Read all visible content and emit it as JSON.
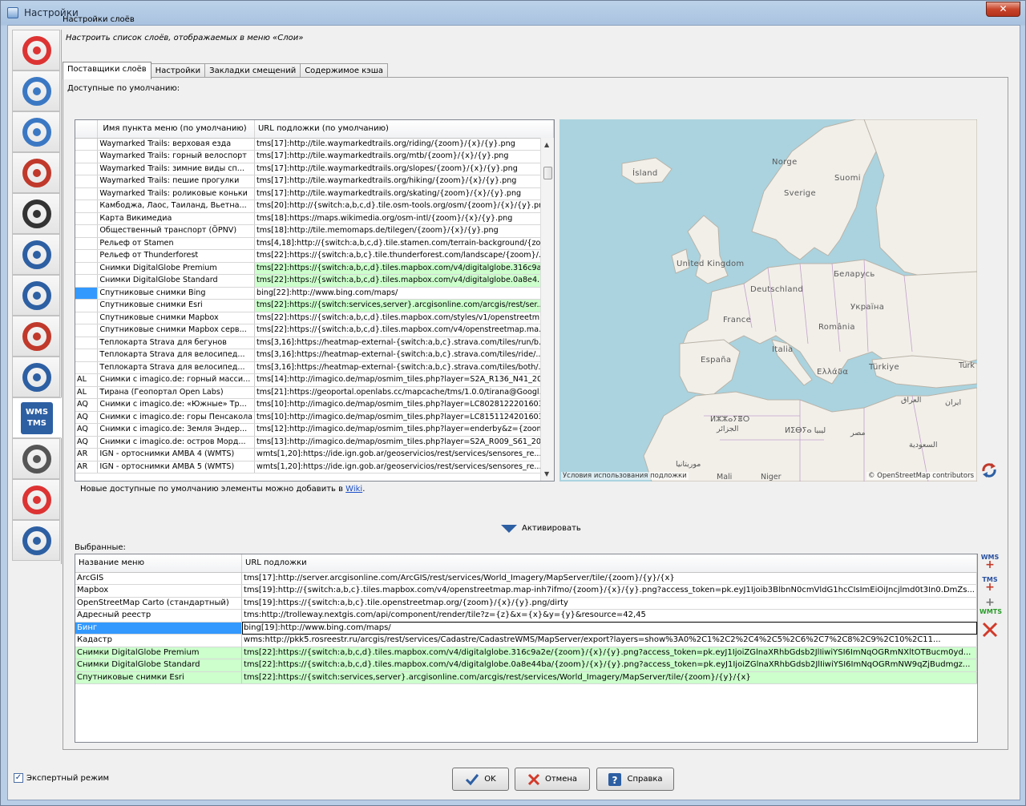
{
  "window": {
    "title": "Настройки",
    "close_label": "✕"
  },
  "header": {
    "title": "Настройки слоёв",
    "description": "Настроить список слоёв, отображаемых в меню «Слои»"
  },
  "sidebar": {
    "items": [
      {
        "icon": "display-settings-icon"
      },
      {
        "icon": "cloud-connection-icon"
      },
      {
        "icon": "globe-projection-icon"
      },
      {
        "icon": "plugin-puzzle-icon"
      },
      {
        "icon": "file-storage-icon"
      },
      {
        "icon": "audio-speaker-icon"
      },
      {
        "icon": "keyboard-icon"
      },
      {
        "icon": "validator-checkbox-icon"
      },
      {
        "icon": "remote-control-icon"
      },
      {
        "icon": "wms-tms-icon",
        "label": "WMS TMS",
        "active": true
      },
      {
        "icon": "advanced-tools-icon"
      },
      {
        "icon": "map-paint-icon"
      },
      {
        "icon": "advanced-gears-icon"
      }
    ]
  },
  "tabs": [
    {
      "label": "Поставщики слоёв",
      "active": true
    },
    {
      "label": "Настройки"
    },
    {
      "label": "Закладки смещений"
    },
    {
      "label": "Содержимое кэша"
    }
  ],
  "available": {
    "label": "Доступные по умолчанию:",
    "columns": [
      "",
      "Имя пункта меню (по умолчанию)",
      "URL подложки (по умолчанию)"
    ],
    "rows": [
      {
        "cc": "",
        "name": "Waymarked Trails: верховая езда",
        "url": "tms[17]:http://tile.waymarkedtrails.org/riding/{zoom}/{x}/{y}.png"
      },
      {
        "cc": "",
        "name": "Waymarked Trails: горный велоспорт",
        "url": "tms[17]:http://tile.waymarkedtrails.org/mtb/{zoom}/{x}/{y}.png"
      },
      {
        "cc": "",
        "name": "Waymarked Trails: зимние виды сп...",
        "url": "tms[17]:http://tile.waymarkedtrails.org/slopes/{zoom}/{x}/{y}.png"
      },
      {
        "cc": "",
        "name": "Waymarked Trails: пешие прогулки",
        "url": "tms[17]:http://tile.waymarkedtrails.org/hiking/{zoom}/{x}/{y}.png"
      },
      {
        "cc": "",
        "name": "Waymarked Trails: роликовые коньки",
        "url": "tms[17]:http://tile.waymarkedtrails.org/skating/{zoom}/{x}/{y}.png"
      },
      {
        "cc": "",
        "name": "Камбоджа, Лаос, Таиланд, Вьетна...",
        "url": "tms[20]:http://{switch:a,b,c,d}.tile.osm-tools.org/osm/{zoom}/{x}/{y}.png"
      },
      {
        "cc": "",
        "name": "Карта Викимедиа",
        "url": "tms[18]:https://maps.wikimedia.org/osm-intl/{zoom}/{x}/{y}.png"
      },
      {
        "cc": "",
        "name": "Общественный транспорт (ÖPNV)",
        "url": "tms[18]:http://tile.memomaps.de/tilegen/{zoom}/{x}/{y}.png"
      },
      {
        "cc": "",
        "name": "Рельеф от Stamen",
        "url": "tms[4,18]:http://{switch:a,b,c,d}.tile.stamen.com/terrain-background/{zo..."
      },
      {
        "cc": "",
        "name": "Рельеф от Thunderforest",
        "url": "tms[22]:https://{switch:a,b,c}.tile.thunderforest.com/landscape/{zoom}/..."
      },
      {
        "cc": "",
        "name": "Снимки DigitalGlobe Premium",
        "url": "tms[22]:https://{switch:a,b,c,d}.tiles.mapbox.com/v4/digitalglobe.316c9a...",
        "green": true
      },
      {
        "cc": "",
        "name": "Снимки DigitalGlobe Standard",
        "url": "tms[22]:https://{switch:a,b,c,d}.tiles.mapbox.com/v4/digitalglobe.0a8e4...",
        "green": true
      },
      {
        "cc": "",
        "name": "Спутниковые снимки Bing",
        "url": "bing[22]:http://www.bing.com/maps/",
        "selected": true
      },
      {
        "cc": "",
        "name": "Спутниковые снимки Esri",
        "url": "tms[22]:https://{switch:services,server}.arcgisonline.com/arcgis/rest/ser...",
        "green": true
      },
      {
        "cc": "",
        "name": "Спутниковые снимки Mapbox",
        "url": "tms[22]:https://{switch:a,b,c,d}.tiles.mapbox.com/styles/v1/openstreetm..."
      },
      {
        "cc": "",
        "name": "Спутниковые снимки Mapbox серв...",
        "url": "tms[22]:https://{switch:a,b,c,d}.tiles.mapbox.com/v4/openstreetmap.ma..."
      },
      {
        "cc": "",
        "name": "Теплокарта Strava для бегунов",
        "url": "tms[3,16]:https://heatmap-external-{switch:a,b,c}.strava.com/tiles/run/b..."
      },
      {
        "cc": "",
        "name": "Теплокарта Strava для велосипед...",
        "url": "tms[3,16]:https://heatmap-external-{switch:a,b,c}.strava.com/tiles/ride/..."
      },
      {
        "cc": "",
        "name": "Теплокарта Strava для велосипед...",
        "url": "tms[3,16]:https://heatmap-external-{switch:a,b,c}.strava.com/tiles/both/..."
      },
      {
        "cc": "AL",
        "name": "Снимки с imagico.de: горный масси...",
        "url": "tms[14]:http://imagico.de/map/osmim_tiles.php?layer=S2A_R136_N41_20..."
      },
      {
        "cc": "AL",
        "name": "Тирана (Геопортал Open Labs)",
        "url": "tms[21]:https://geoportal.openlabs.cc/mapcache/tms/1.0.0/tirana@Googl..."
      },
      {
        "cc": "AQ",
        "name": "Снимки с imagico.de: «Южные» Тр...",
        "url": "tms[10]:http://imagico.de/map/osmim_tiles.php?layer=LC8028122201603..."
      },
      {
        "cc": "AQ",
        "name": "Снимки с imagico.de: горы Пенсакола",
        "url": "tms[10]:http://imagico.de/map/osmim_tiles.php?layer=LC8151124201603..."
      },
      {
        "cc": "AQ",
        "name": "Снимки с imagico.de: Земля Эндер...",
        "url": "tms[12]:http://imagico.de/map/osmim_tiles.php?layer=enderby&z={zoom..."
      },
      {
        "cc": "AQ",
        "name": "Снимки с imagico.de: остров Морд...",
        "url": "tms[13]:http://imagico.de/map/osmim_tiles.php?layer=S2A_R009_S61_20..."
      },
      {
        "cc": "AR",
        "name": "IGN - ортоснимки AMBA 4 (WMTS)",
        "url": "wmts[1,20]:https://ide.ign.gob.ar/geoservicios/rest/services/sensores_re..."
      },
      {
        "cc": "AR",
        "name": "IGN - ортоснимки AMBA 5 (WMTS)",
        "url": "wmts[1,20]:https://ide.ign.gob.ar/geoservicios/rest/services/sensores_re..."
      }
    ]
  },
  "map": {
    "labels": [
      "Ísland",
      "Norge",
      "Suomi",
      "Sverige",
      "United Kingdom",
      "Беларусь",
      "Deutschland",
      "Україна",
      "France",
      "România",
      "Italia",
      "España",
      "Ελλάδα",
      "Türkiye",
      "Türk",
      "ⵍⵣⵣⴰⵢⴻⵔ",
      "الجزائر",
      "ⵍⵉⴱⵢⴰ ليبيا",
      "مصر",
      "العراق",
      "ایران",
      "السعودية",
      "موريتانيا",
      "Mali",
      "Niger"
    ],
    "terms": "Условия использования подложки",
    "attribution": "© OpenStreetMap contributors"
  },
  "wiki_note": {
    "text": "Новые доступные по умолчанию элементы можно добавить в ",
    "link": "Wiki",
    "tail": "."
  },
  "activate_label": "Активировать",
  "selected": {
    "label": "Выбранные:",
    "columns": [
      "Название меню",
      "URL подложки"
    ],
    "rows": [
      {
        "name": "ArcGIS",
        "url": "tms[17]:http://server.arcgisonline.com/ArcGIS/rest/services/World_Imagery/MapServer/tile/{zoom}/{y}/{x}"
      },
      {
        "name": "Mapbox",
        "url": "tms[19]:http://{switch:a,b,c}.tiles.mapbox.com/v4/openstreetmap.map-inh7ifmo/{zoom}/{x}/{y}.png?access_token=pk.eyJ1Ijoib3BlbnN0cmVldG1hcCIsImEiOiJncjlmd0t3In0.DmZs..."
      },
      {
        "name": "OpenStreetMap Carto (стандартный)",
        "url": "tms[19]:https://{switch:a,b,c}.tile.openstreetmap.org/{zoom}/{x}/{y}.png/dirty"
      },
      {
        "name": "Адресный реестр",
        "url": "tms:http://trolleway.nextgis.com/api/component/render/tile?z={z}&x={x}&y={y}&resource=42,45"
      },
      {
        "name": "Бинг",
        "url": "bing[19]:http://www.bing.com/maps/",
        "selected": true
      },
      {
        "name": "Кадастр",
        "url": "wms:http://pkk5.rosreestr.ru/arcgis/rest/services/Cadastre/CadastreWMS/MapServer/export?layers=show%3A0%2C1%2C2%2C4%2C5%2C6%2C7%2C8%2C9%2C10%2C11..."
      },
      {
        "name": "Снимки DigitalGlobe Premium",
        "url": "tms[22]:https://{switch:a,b,c,d}.tiles.mapbox.com/v4/digitalglobe.316c9a2e/{zoom}/{x}/{y}.png?access_token=pk.eyJ1IjoiZGlnaXRhbGdsb2JlIiwiYSI6ImNqOGRmNXltOTBucm0yd...",
        "green": true
      },
      {
        "name": "Снимки DigitalGlobe Standard",
        "url": "tms[22]:https://{switch:a,b,c,d}.tiles.mapbox.com/v4/digitalglobe.0a8e44ba/{zoom}/{x}/{y}.png?access_token=pk.eyJ1IjoiZGlnaXRhbGdsb2JlIiwiYSI6ImNqOGRmNW9qZjBudmgz...",
        "green": true
      },
      {
        "name": "Спутниковые снимки Esri",
        "url": "tms[22]:https://{switch:services,server}.arcgisonline.com/arcgis/rest/services/World_Imagery/MapServer/tile/{zoom}/{y}/{x}",
        "green": true
      }
    ]
  },
  "tools": {
    "wms": "WMS",
    "tms": "TMS",
    "wmts": "WMTS"
  },
  "footer": {
    "expert_label": "Экспертный режим",
    "expert_checked": true,
    "ok": "OK",
    "cancel": "Отмена",
    "help": "Справка"
  },
  "colors": {
    "green_row": "#ccffcc",
    "selection": "#3399ff",
    "accent": "#2d5fa3"
  }
}
